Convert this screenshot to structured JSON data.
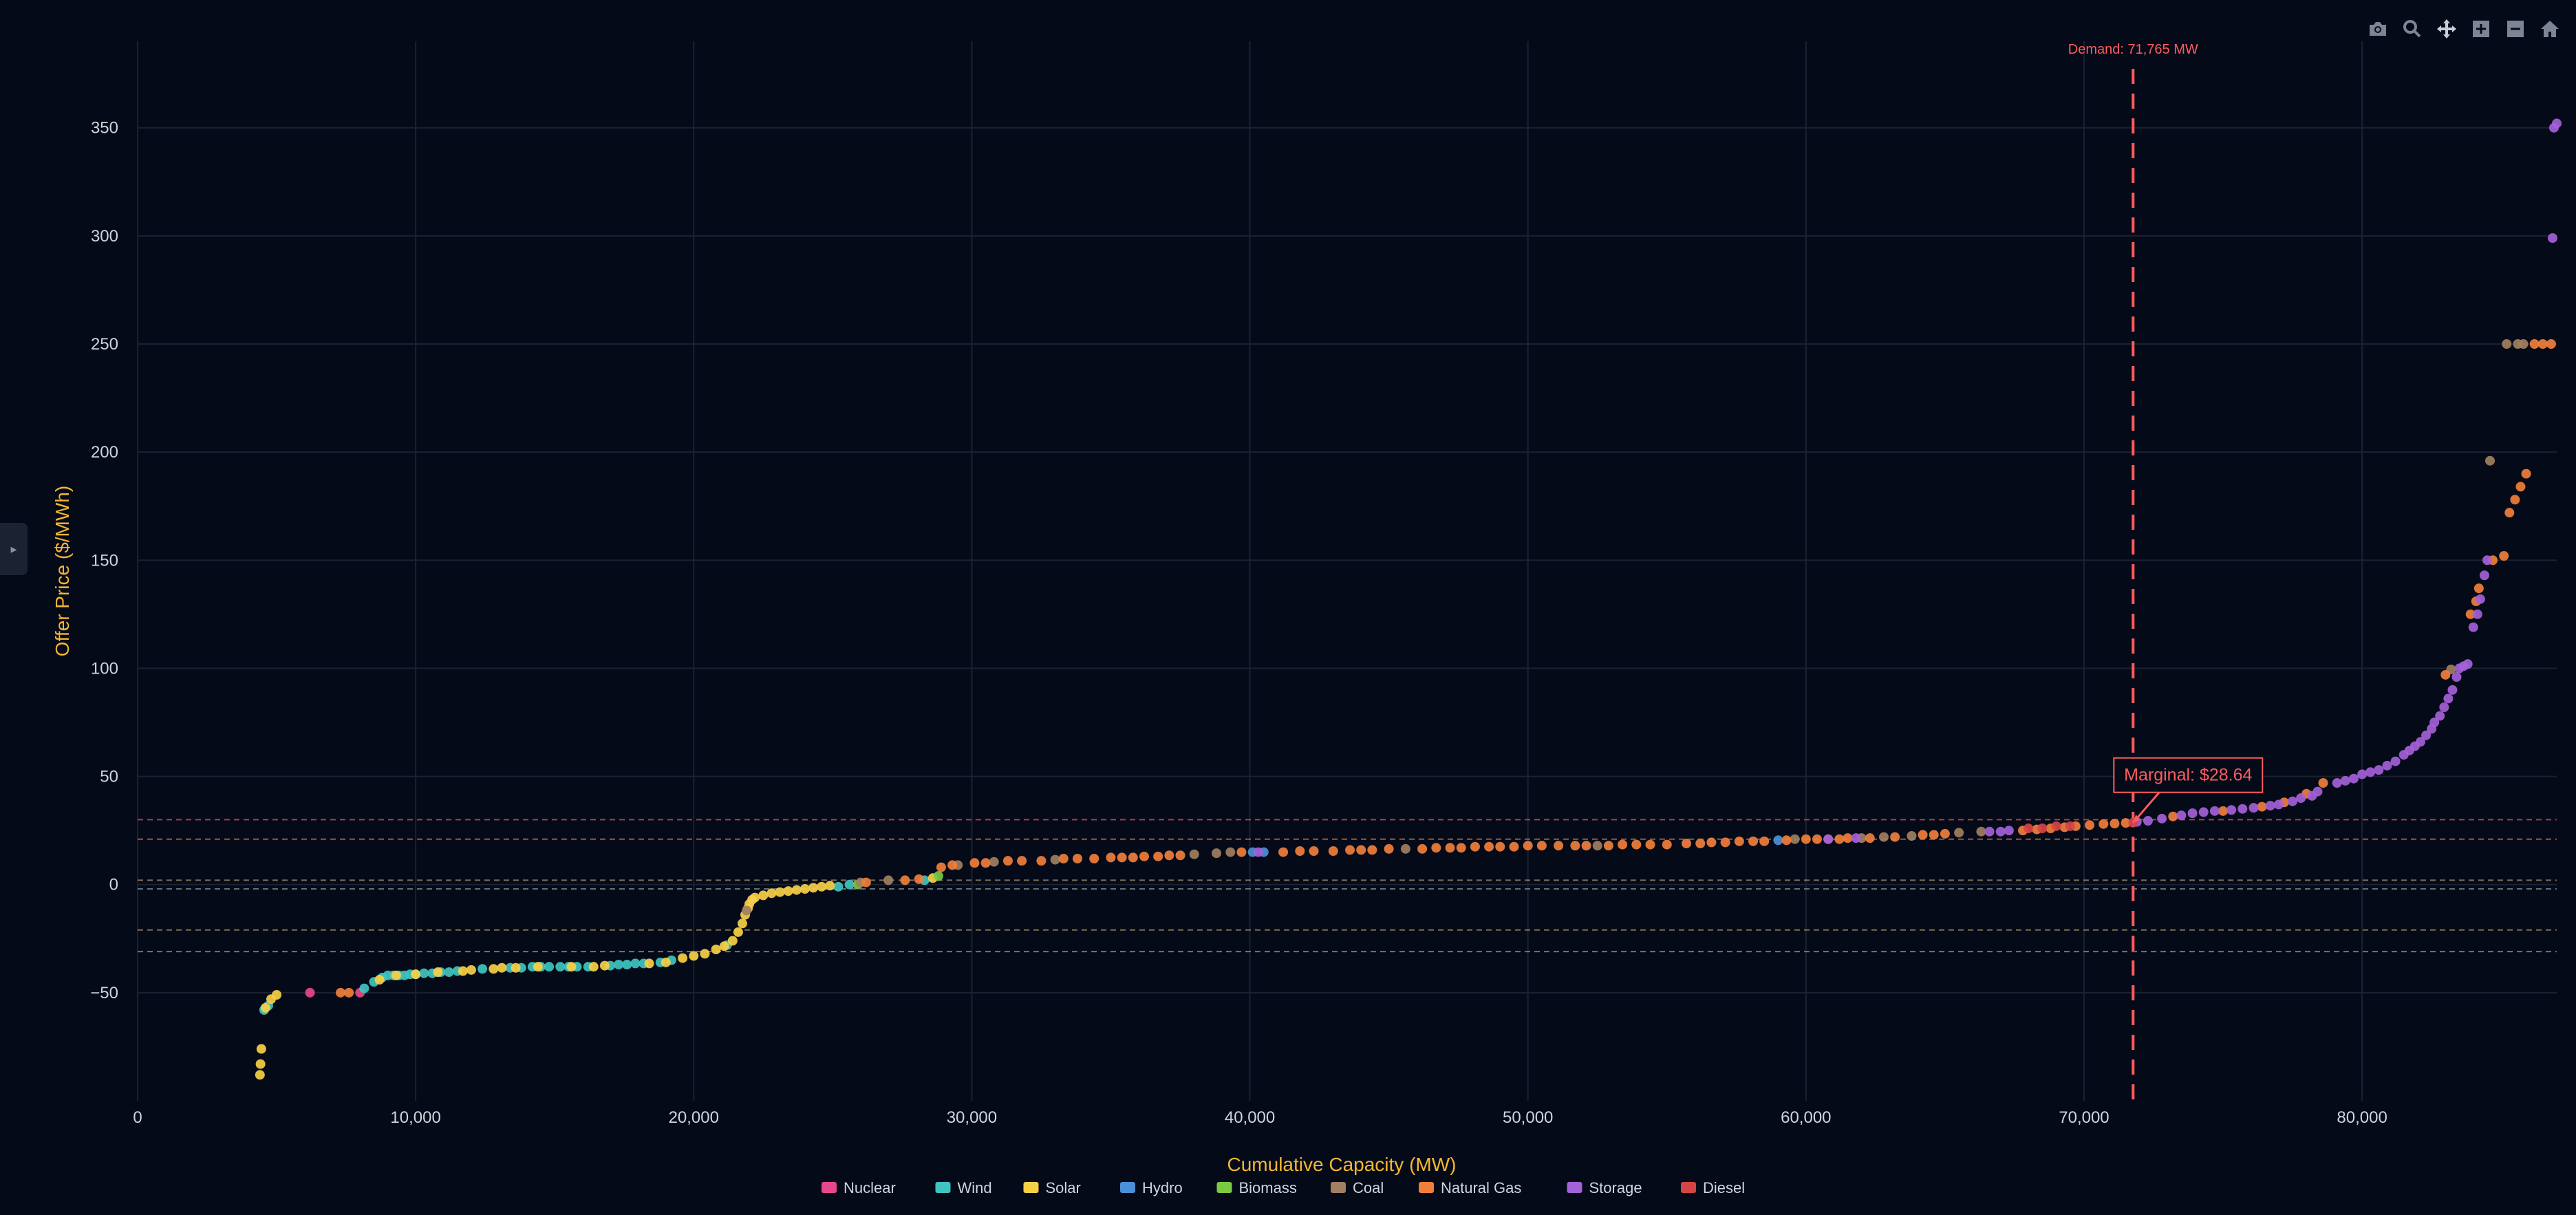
{
  "toolbar": {
    "items": [
      {
        "name": "camera-icon"
      },
      {
        "name": "zoom-icon"
      },
      {
        "name": "pan-icon"
      },
      {
        "name": "zoom-in-icon"
      },
      {
        "name": "zoom-out-icon"
      },
      {
        "name": "reset-home-icon"
      }
    ]
  },
  "sidebar_toggle": {
    "icon": "▸"
  },
  "chart_data": {
    "type": "scatter",
    "xlabel": "Cumulative Capacity (MW)",
    "ylabel": "Offer Price ($/MWh)",
    "xlim": [
      0,
      87000
    ],
    "ylim": [
      -100,
      390
    ],
    "x_ticks": [
      0,
      10000,
      20000,
      30000,
      40000,
      50000,
      60000,
      70000,
      80000
    ],
    "x_tick_labels": [
      "0",
      "10,000",
      "20,000",
      "30,000",
      "40,000",
      "50,000",
      "60,000",
      "70,000",
      "80,000"
    ],
    "y_ticks": [
      -50,
      0,
      50,
      100,
      150,
      200,
      250,
      300,
      350
    ],
    "y_tick_labels": [
      "−50",
      "0",
      "50",
      "100",
      "150",
      "200",
      "250",
      "300",
      "350"
    ],
    "grid": true,
    "demand": {
      "x": 71765,
      "label": "Demand: 71,765 MW",
      "color": "#ff5c5c"
    },
    "marginal": {
      "x": 71765,
      "y": 28.64,
      "label": "Marginal: $28.64",
      "color": "#ff5c5c"
    },
    "reference_lines": [
      {
        "y": 30,
        "color": "#d45050"
      },
      {
        "y": 21,
        "color": "#c0704a"
      },
      {
        "y": 2,
        "color": "#9a8a70"
      },
      {
        "y": -2,
        "color": "#7a8a90"
      },
      {
        "y": -21,
        "color": "#a08a5a"
      },
      {
        "y": -31,
        "color": "#8a8f9a"
      }
    ],
    "legend_position": "bottom-center",
    "series": [
      {
        "name": "Nuclear",
        "color": "#e8488a",
        "points": [
          [
            6200,
            -50
          ],
          [
            8000,
            -50
          ]
        ]
      },
      {
        "name": "Wind",
        "color": "#3fc4c0",
        "points": [
          [
            4550,
            -58
          ],
          [
            4700,
            -56
          ],
          [
            8150,
            -48
          ],
          [
            8500,
            -45
          ],
          [
            8800,
            -43
          ],
          [
            9000,
            -42
          ],
          [
            9200,
            -42
          ],
          [
            9400,
            -42
          ],
          [
            9600,
            -42
          ],
          [
            9800,
            -41.5
          ],
          [
            10000,
            -41.5
          ],
          [
            10300,
            -41
          ],
          [
            10600,
            -41
          ],
          [
            10900,
            -40.5
          ],
          [
            11200,
            -40.5
          ],
          [
            11500,
            -40
          ],
          [
            12400,
            -39
          ],
          [
            13400,
            -38.5
          ],
          [
            13800,
            -38.5
          ],
          [
            14200,
            -38
          ],
          [
            14500,
            -38
          ],
          [
            14800,
            -38
          ],
          [
            15200,
            -38
          ],
          [
            15500,
            -38
          ],
          [
            15800,
            -38
          ],
          [
            16200,
            -38
          ],
          [
            17000,
            -37.5
          ],
          [
            17300,
            -37
          ],
          [
            17600,
            -37
          ],
          [
            17900,
            -36.5
          ],
          [
            18200,
            -36.5
          ],
          [
            18800,
            -36
          ],
          [
            19200,
            -35
          ],
          [
            21200,
            -28
          ],
          [
            25200,
            -1
          ],
          [
            25600,
            0
          ],
          [
            28300,
            2
          ]
        ]
      },
      {
        "name": "Solar",
        "color": "#f7d046",
        "points": [
          [
            4400,
            -88
          ],
          [
            4420,
            -83
          ],
          [
            4450,
            -76
          ],
          [
            4600,
            -57
          ],
          [
            4800,
            -53
          ],
          [
            5000,
            -51
          ],
          [
            8700,
            -44
          ],
          [
            9300,
            -42
          ],
          [
            10000,
            -41.5
          ],
          [
            10800,
            -40.5
          ],
          [
            11700,
            -40
          ],
          [
            12000,
            -39.5
          ],
          [
            12800,
            -39
          ],
          [
            13100,
            -38.5
          ],
          [
            13600,
            -38.5
          ],
          [
            14400,
            -38
          ],
          [
            15600,
            -38
          ],
          [
            16400,
            -38
          ],
          [
            16800,
            -37.5
          ],
          [
            18400,
            -36.5
          ],
          [
            19000,
            -36
          ],
          [
            19600,
            -34
          ],
          [
            20000,
            -33
          ],
          [
            20400,
            -32
          ],
          [
            20800,
            -30
          ],
          [
            21100,
            -28.5
          ],
          [
            21400,
            -26
          ],
          [
            21600,
            -22
          ],
          [
            21750,
            -18
          ],
          [
            21850,
            -14
          ],
          [
            21950,
            -11
          ],
          [
            22000,
            -9
          ],
          [
            22100,
            -7
          ],
          [
            22200,
            -6
          ],
          [
            22500,
            -5
          ],
          [
            22800,
            -4
          ],
          [
            23100,
            -3.5
          ],
          [
            23400,
            -3
          ],
          [
            23700,
            -2.5
          ],
          [
            24000,
            -2
          ],
          [
            24300,
            -1.5
          ],
          [
            24600,
            -1
          ],
          [
            24900,
            -0.5
          ],
          [
            28600,
            3
          ]
        ]
      },
      {
        "name": "Hydro",
        "color": "#4a90d9",
        "points": [
          [
            40100,
            15
          ],
          [
            40500,
            15
          ],
          [
            59000,
            20.5
          ]
        ]
      },
      {
        "name": "Biomass",
        "color": "#7ac943",
        "points": [
          [
            25900,
            0
          ],
          [
            28800,
            4
          ]
        ]
      },
      {
        "name": "Coal",
        "color": "#a08060",
        "points": [
          [
            21900,
            -12
          ],
          [
            26000,
            1
          ],
          [
            27000,
            2
          ],
          [
            29500,
            9
          ],
          [
            30800,
            10.5
          ],
          [
            33000,
            11.5
          ],
          [
            38000,
            14
          ],
          [
            38800,
            14.5
          ],
          [
            39300,
            15
          ],
          [
            45600,
            16.5
          ],
          [
            52500,
            18
          ],
          [
            59600,
            21
          ],
          [
            62000,
            21.5
          ],
          [
            62800,
            22
          ],
          [
            63800,
            22.5
          ],
          [
            65500,
            24
          ],
          [
            66300,
            24.5
          ],
          [
            83200,
            99.5
          ],
          [
            84600,
            196
          ],
          [
            85200,
            250
          ],
          [
            85600,
            250
          ],
          [
            85800,
            250
          ]
        ]
      },
      {
        "name": "Natural Gas",
        "color": "#f07f3c",
        "points": [
          [
            7300,
            -50
          ],
          [
            7600,
            -50
          ],
          [
            26200,
            1
          ],
          [
            27600,
            2
          ],
          [
            28100,
            2.5
          ],
          [
            28900,
            8
          ],
          [
            29300,
            9
          ],
          [
            30100,
            10
          ],
          [
            30500,
            10
          ],
          [
            31300,
            11
          ],
          [
            31800,
            11
          ],
          [
            32500,
            11
          ],
          [
            33300,
            12
          ],
          [
            33800,
            12
          ],
          [
            34400,
            12
          ],
          [
            35000,
            12.5
          ],
          [
            35400,
            12.5
          ],
          [
            35800,
            12.5
          ],
          [
            36200,
            13
          ],
          [
            36700,
            13
          ],
          [
            37100,
            13.5
          ],
          [
            37500,
            13.5
          ],
          [
            39700,
            15
          ],
          [
            41200,
            15
          ],
          [
            41800,
            15.5
          ],
          [
            42300,
            15.5
          ],
          [
            43000,
            15.5
          ],
          [
            43600,
            16
          ],
          [
            44000,
            16
          ],
          [
            44400,
            16
          ],
          [
            45000,
            16.5
          ],
          [
            46200,
            16.5
          ],
          [
            46700,
            17
          ],
          [
            47200,
            17
          ],
          [
            47600,
            17
          ],
          [
            48100,
            17.5
          ],
          [
            48600,
            17.5
          ],
          [
            49000,
            17.5
          ],
          [
            49500,
            17.5
          ],
          [
            50000,
            18
          ],
          [
            50500,
            18
          ],
          [
            51100,
            18
          ],
          [
            51700,
            18
          ],
          [
            52100,
            18
          ],
          [
            52900,
            18
          ],
          [
            53400,
            18.5
          ],
          [
            53900,
            18.5
          ],
          [
            54400,
            18.5
          ],
          [
            55000,
            18.5
          ],
          [
            55700,
            19
          ],
          [
            56200,
            19
          ],
          [
            56600,
            19.5
          ],
          [
            57100,
            19.5
          ],
          [
            57600,
            20
          ],
          [
            58100,
            20
          ],
          [
            58500,
            20
          ],
          [
            59300,
            20.5
          ],
          [
            60000,
            21
          ],
          [
            60400,
            21
          ],
          [
            60800,
            21
          ],
          [
            61200,
            21
          ],
          [
            61500,
            21.5
          ],
          [
            62300,
            21.5
          ],
          [
            63200,
            22
          ],
          [
            64200,
            23
          ],
          [
            64600,
            23
          ],
          [
            65000,
            23.5
          ],
          [
            67800,
            25
          ],
          [
            68300,
            25.5
          ],
          [
            68800,
            26
          ],
          [
            69300,
            26.5
          ],
          [
            69700,
            27
          ],
          [
            70200,
            27.5
          ],
          [
            70700,
            28
          ],
          [
            71100,
            28.2
          ],
          [
            71500,
            28.5
          ],
          [
            73200,
            31.5
          ],
          [
            75000,
            34
          ],
          [
            76400,
            36
          ],
          [
            77200,
            38
          ],
          [
            78000,
            42
          ],
          [
            78600,
            47
          ],
          [
            83000,
            97
          ],
          [
            83900,
            125
          ],
          [
            84100,
            131
          ],
          [
            84200,
            137
          ],
          [
            84700,
            150
          ],
          [
            85100,
            152
          ],
          [
            85300,
            172
          ],
          [
            85500,
            178
          ],
          [
            85700,
            184
          ],
          [
            85900,
            190
          ],
          [
            86200,
            250
          ],
          [
            86500,
            250
          ],
          [
            86800,
            250
          ]
        ]
      },
      {
        "name": "Storage",
        "color": "#a461d8",
        "points": [
          [
            40300,
            15
          ],
          [
            60800,
            21
          ],
          [
            61800,
            21.5
          ],
          [
            66600,
            24.5
          ],
          [
            67000,
            24.5
          ],
          [
            67300,
            25
          ],
          [
            71900,
            29
          ],
          [
            72300,
            29.5
          ],
          [
            72800,
            30.5
          ],
          [
            73500,
            32
          ],
          [
            73900,
            33
          ],
          [
            74300,
            33.5
          ],
          [
            74700,
            34
          ],
          [
            75300,
            34.5
          ],
          [
            75700,
            35
          ],
          [
            76100,
            35.5
          ],
          [
            76700,
            36.5
          ],
          [
            77000,
            37
          ],
          [
            77500,
            38.5
          ],
          [
            77800,
            40
          ],
          [
            78200,
            41
          ],
          [
            78400,
            43
          ],
          [
            79100,
            47
          ],
          [
            79400,
            48
          ],
          [
            79700,
            49
          ],
          [
            80000,
            51
          ],
          [
            80300,
            52
          ],
          [
            80600,
            53
          ],
          [
            80900,
            55
          ],
          [
            81200,
            57
          ],
          [
            81500,
            60
          ],
          [
            81700,
            62
          ],
          [
            81900,
            64
          ],
          [
            82100,
            66
          ],
          [
            82300,
            69
          ],
          [
            82500,
            72
          ],
          [
            82600,
            75
          ],
          [
            82800,
            78
          ],
          [
            82950,
            82
          ],
          [
            83100,
            86
          ],
          [
            83250,
            90
          ],
          [
            83400,
            96
          ],
          [
            83500,
            100
          ],
          [
            83650,
            101
          ],
          [
            83800,
            102
          ],
          [
            84000,
            119
          ],
          [
            84150,
            125
          ],
          [
            84250,
            132
          ],
          [
            84400,
            143
          ],
          [
            84500,
            150
          ],
          [
            86850,
            299
          ],
          [
            86900,
            350
          ],
          [
            87000,
            352
          ]
        ]
      },
      {
        "name": "Diesel",
        "color": "#d64545",
        "points": [
          [
            68000,
            26
          ],
          [
            68500,
            26
          ],
          [
            69000,
            27
          ],
          [
            69500,
            27
          ],
          [
            71765,
            28.64
          ]
        ]
      }
    ]
  }
}
